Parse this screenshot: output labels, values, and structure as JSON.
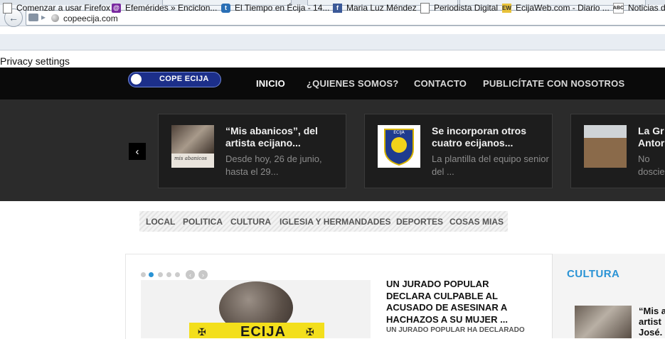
{
  "browser": {
    "url": "copeecija.com",
    "bookmarks": [
      {
        "label": "Comenzar a usar Firefox",
        "icon": "blank-page-icon"
      },
      {
        "label": "Efemérides » Enciclon...",
        "icon": "purple-swirl-icon"
      },
      {
        "label": "El Tiempo en Écija - 14...",
        "icon": "weather-icon"
      },
      {
        "label": "Maria Luz Méndez",
        "icon": "facebook-icon"
      },
      {
        "label": "Periodista Digital",
        "icon": "blank-page-icon"
      },
      {
        "label": "EcijaWeb.com - Diario ...",
        "icon": "ew-icon"
      },
      {
        "label": "Noticias d",
        "icon": "abc-icon"
      }
    ]
  },
  "privacy": "Privacy settings",
  "site": {
    "logo_text": "COPE ECIJA",
    "nav": [
      "INICIO",
      "¿QUIENES SOMOS?",
      "CONTACTO",
      "PUBLICÍTATE CON NOSOTROS"
    ],
    "slider": [
      {
        "title": "“Mis abanicos”, del artista ecijano...",
        "excerpt": "Desde hoy, 26 de junio, hasta el 29...",
        "thumb_caption": "mis abanicos"
      },
      {
        "title": "Se incorporan otros cuatro ecijanos...",
        "excerpt": "La plantilla del equipo senior del ...",
        "thumb_caption": ""
      },
      {
        "title": "La Gr Antor",
        "excerpt": "No doscie",
        "thumb_caption": ""
      }
    ],
    "categories": [
      "LOCAL",
      "POLITICA",
      "CULTURA",
      "IGLESIA Y HERMANDADES",
      "DEPORTES",
      "COSAS MIAS"
    ],
    "feature": {
      "headline": "UN JURADO POPULAR DECLARA CULPABLE AL ACUSADO DE ASESINAR A HACHAZOS A SU MUJER ...",
      "subline": "UN JURADO POPULAR HA DECLARADO",
      "image_text": "ECIJA"
    },
    "sidebar": {
      "heading": "CULTURA",
      "item_title": "“Mis a artist José."
    }
  },
  "colors": {
    "accent": "#2a93d5",
    "topbar": "#0a0a0a",
    "slider_bg": "#2b2b2b"
  }
}
